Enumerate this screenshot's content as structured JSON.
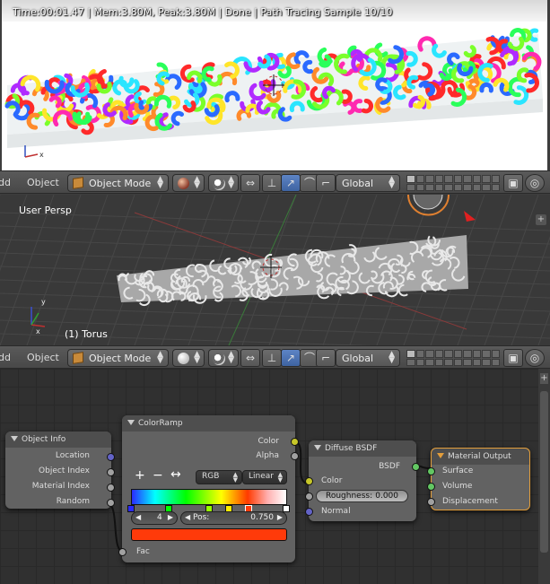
{
  "render_view": {
    "status": "Time:00:01.47 | Mem:3.80M, Peak:3.80M | Done | Path Tracing Sample 10/10"
  },
  "header_top": {
    "left_partial": "dd",
    "object_menu": "Object",
    "mode": "Object Mode",
    "orientation": "Global",
    "viewport_shading": "rendered"
  },
  "viewport": {
    "view_label": "User Persp",
    "object_label": "(1) Torus"
  },
  "header_bottom": {
    "left_partial": "dd",
    "object_menu": "Object",
    "mode": "Object Mode",
    "orientation": "Global",
    "viewport_shading": "solid"
  },
  "nodes": {
    "object_info": {
      "title": "Object Info",
      "outputs": [
        "Location",
        "Object Index",
        "Material Index",
        "Random"
      ]
    },
    "color_ramp": {
      "title": "ColorRamp",
      "outputs": [
        "Color",
        "Alpha"
      ],
      "add": "+",
      "remove": "−",
      "flip": "↔",
      "color_mode": "RGB",
      "interpolation": "Linear",
      "active_stop": "4",
      "pos_label": "Pos:",
      "pos_value": "0.750",
      "input": "Fac",
      "swatch_color": "#ff3a0a"
    },
    "diffuse_bsdf": {
      "title": "Diffuse BSDF",
      "output": "BSDF",
      "inputs": [
        "Color",
        "Normal"
      ],
      "roughness_label": "Roughness:",
      "roughness_value": "0.000"
    },
    "material_output": {
      "title": "Material Output",
      "inputs": [
        "Surface",
        "Volume",
        "Displacement"
      ]
    }
  }
}
